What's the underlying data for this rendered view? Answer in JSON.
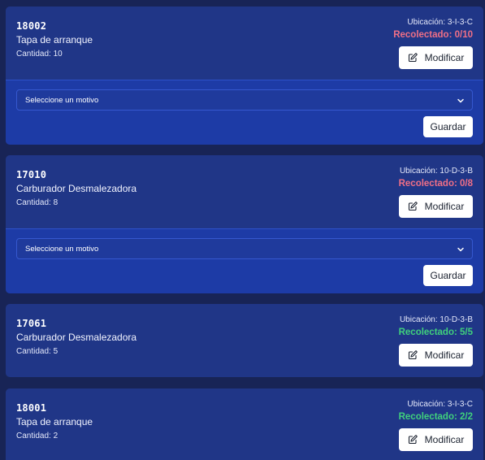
{
  "items": [
    {
      "code": "18002",
      "name": "Tapa de arranque",
      "quantity": "Cantidad: 10",
      "location": "Ubicación: 3-I-3-C",
      "collected": "Recolectado: 0/10",
      "collected_status": "pending",
      "edit_label": "Modificar",
      "reason_placeholder": "Seleccione un motivo",
      "save_label": "Guardar"
    },
    {
      "code": "17010",
      "name": "Carburador Desmalezadora",
      "quantity": "Cantidad: 8",
      "location": "Ubicación: 10-D-3-B",
      "collected": "Recolectado: 0/8",
      "collected_status": "pending",
      "edit_label": "Modificar",
      "reason_placeholder": "Seleccione un motivo",
      "save_label": "Guardar"
    },
    {
      "code": "17061",
      "name": "Carburador Desmalezadora",
      "quantity": "Cantidad: 5",
      "location": "Ubicación: 10-D-3-B",
      "collected": "Recolectado: 5/5",
      "collected_status": "done",
      "edit_label": "Modificar"
    },
    {
      "code": "18001",
      "name": "Tapa de arranque",
      "quantity": "Cantidad: 2",
      "location": "Ubicación: 3-I-3-C",
      "collected": "Recolectado: 2/2",
      "collected_status": "done",
      "edit_label": "Modificar"
    }
  ],
  "colors": {
    "pending": "#f06f86",
    "done": "#40d17c",
    "card": "#203687",
    "card_footer": "#1d3ba6"
  },
  "icons": {
    "edit": "edit-icon",
    "dropdown": "chevron-down-icon"
  }
}
